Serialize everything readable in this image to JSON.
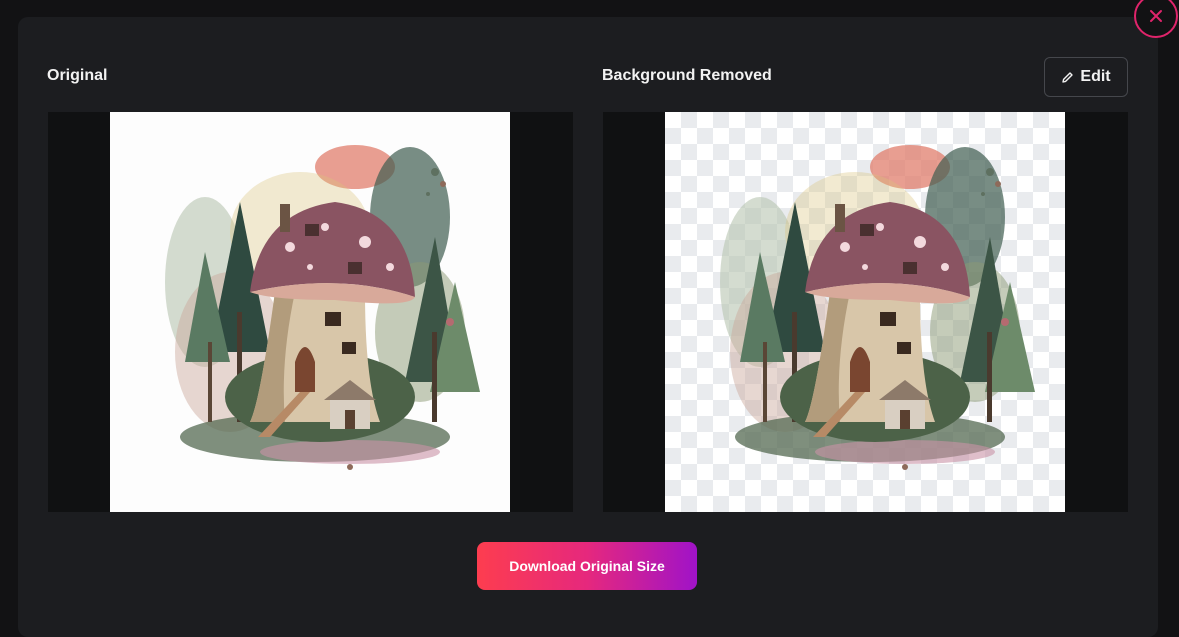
{
  "modal": {
    "original_label": "Original",
    "removed_label": "Background Removed",
    "edit_label": "Edit",
    "download_label": "Download Original Size"
  },
  "icons": {
    "close": "close-icon",
    "edit": "pencil-icon"
  },
  "colors": {
    "accent": "#e0246b",
    "gradient_start": "#fd3d4f",
    "gradient_end": "#a013c8",
    "modal_bg": "#1c1d20"
  }
}
